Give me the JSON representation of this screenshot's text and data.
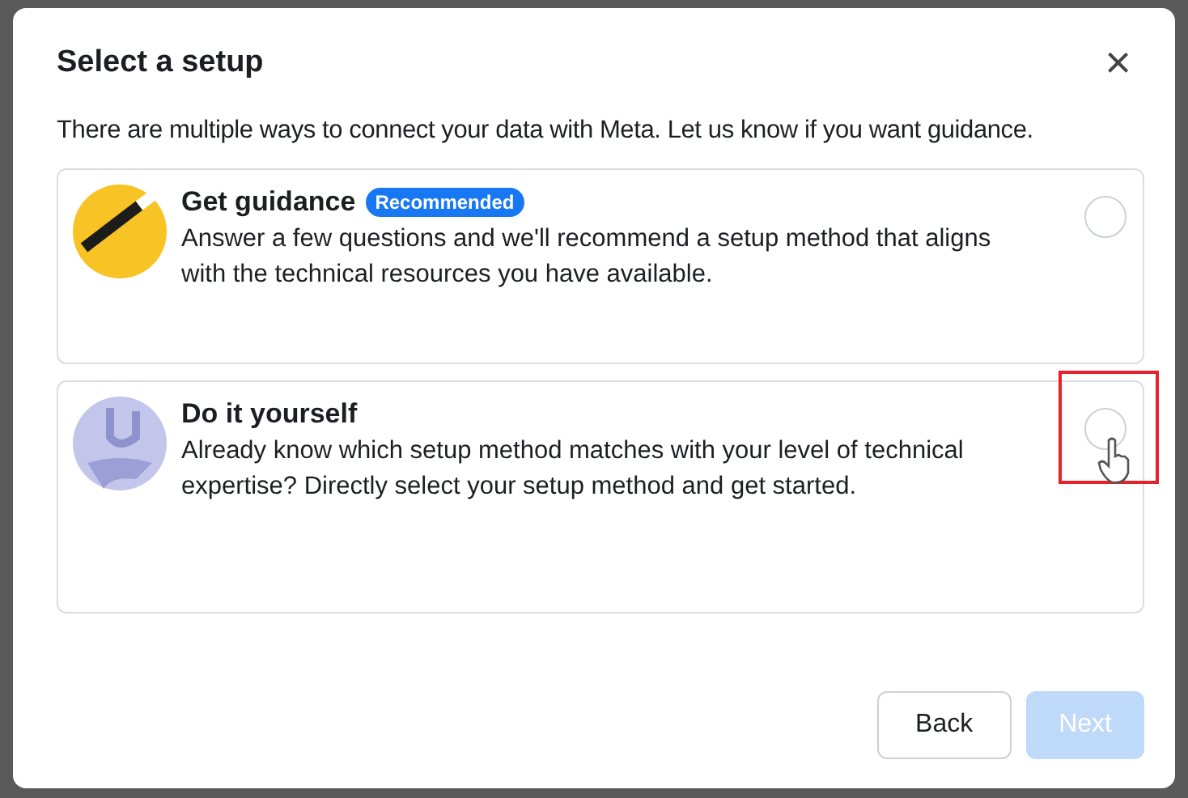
{
  "dialog": {
    "title": "Select a setup",
    "close": "×",
    "description": "There are multiple ways to connect your data with Meta. Let us know if you want guidance.",
    "options": [
      {
        "title": "Get guidance",
        "badge": "Recommended",
        "text": "Answer a few questions and we'll recommend a setup method that aligns with the technical resources you have available.",
        "kind": "wand",
        "selected": false,
        "highlighted": false
      },
      {
        "title": "Do it yourself",
        "text": "Already know which setup method matches with your level of technical expertise? Directly select your setup method and get started.",
        "kind": "wrench",
        "selected": false,
        "highlighted": true
      }
    ],
    "buttons": [
      {
        "label": "Back",
        "disabled": false
      },
      {
        "label": "Next",
        "disabled": true
      }
    ]
  }
}
